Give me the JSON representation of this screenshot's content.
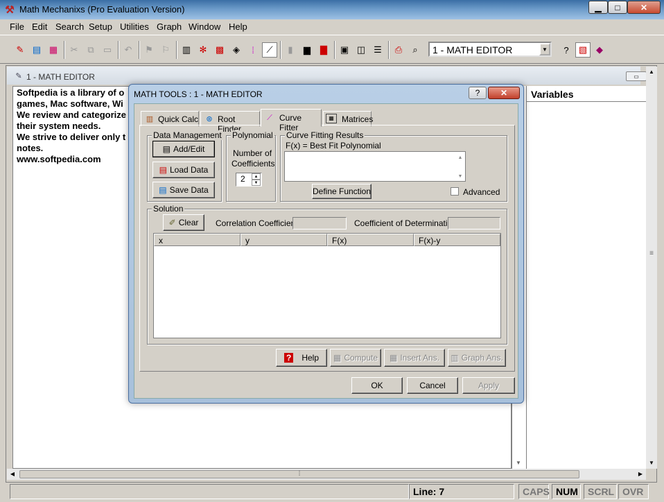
{
  "window": {
    "title": "Math Mechanixs (Pro Evaluation Version)",
    "min_label": "▁",
    "max_label": "□",
    "close_label": "✕"
  },
  "menu": [
    "File",
    "Edit",
    "Search",
    "Setup",
    "Utilities",
    "Graph",
    "Window",
    "Help"
  ],
  "toolbar": {
    "combo_value": "1 - MATH EDITOR"
  },
  "child": {
    "title": "1 - MATH EDITOR"
  },
  "editor": {
    "lines": [
      "Softpedia is a library of o",
      "games, Mac software, Wi",
      "We review and categorize",
      "their system needs.",
      "We strive to deliver only t",
      "notes.",
      "www.softpedia.com"
    ]
  },
  "variables": {
    "header": "Variables"
  },
  "status": {
    "line": "Line: 7",
    "caps": "CAPS",
    "num": "NUM",
    "scrl": "SCRL",
    "ovr": "OVR"
  },
  "dialog": {
    "title": "MATH TOOLS : 1 - MATH EDITOR",
    "help_label": "?",
    "close_label": "✕",
    "tabs": [
      "Quick Calc",
      "Root Finder",
      "Curve Fitter",
      "Matrices"
    ],
    "data_mgmt": {
      "label": "Data Management",
      "add": "Add/Edit",
      "load": "Load Data",
      "save": "Save Data"
    },
    "polynomial": {
      "label": "Polynomial",
      "sub1": "Number of",
      "sub2": "Coefficients",
      "value": "2"
    },
    "results": {
      "label": "Curve Fitting Results",
      "fx": "F(x) = Best Fit Polynomial",
      "define": "Define Function",
      "advanced": "Advanced"
    },
    "solution": {
      "label": "Solution",
      "clear": "Clear",
      "corr": "Correlation Coefficient",
      "det": "Coefficient of Determination",
      "columns": [
        "x",
        "y",
        "F(x)",
        "F(x)-y"
      ]
    },
    "buttons": {
      "help": "Help",
      "compute": "Compute",
      "insert": "Insert Ans.",
      "graph": "Graph Ans.",
      "ok": "OK",
      "cancel": "Cancel",
      "apply": "Apply"
    }
  }
}
